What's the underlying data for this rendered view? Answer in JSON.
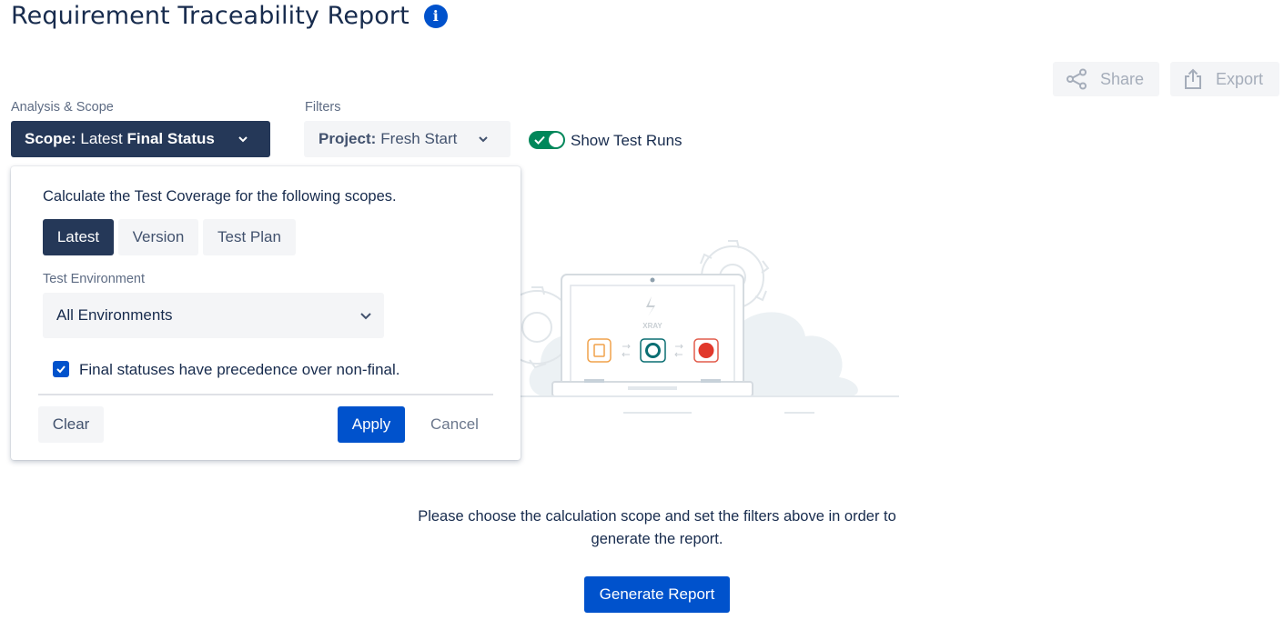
{
  "header": {
    "title": "Requirement Traceability Report",
    "info_glyph": "i"
  },
  "toolbar": {
    "share_label": "Share",
    "export_label": "Export"
  },
  "analysis": {
    "label": "Analysis & Scope",
    "scope_prefix": "Scope:",
    "scope_value": "Latest",
    "scope_suffix": "Final Status"
  },
  "filters": {
    "label": "Filters",
    "project_prefix": "Project:",
    "project_value": "Fresh Start"
  },
  "show_runs": {
    "label": "Show Test Runs",
    "enabled": true
  },
  "popup": {
    "description": "Calculate the Test Coverage for the following scopes.",
    "scopes": [
      {
        "label": "Latest",
        "selected": true
      },
      {
        "label": "Version",
        "selected": false
      },
      {
        "label": "Test Plan",
        "selected": false
      }
    ],
    "environment_label": "Test Environment",
    "environment_value": "All Environments",
    "precedence_label": "Final statuses have precedence over non-final.",
    "precedence_checked": true,
    "clear_label": "Clear",
    "apply_label": "Apply",
    "cancel_label": "Cancel"
  },
  "illustration": {
    "logo_text": "XRAY"
  },
  "main": {
    "hint_line1": "Please choose the calculation scope and set the filters above in order to",
    "hint_line2": "generate the report.",
    "generate_label": "Generate Report"
  },
  "colors": {
    "brand_blue": "#0052cc",
    "dark_navy": "#253858",
    "toggle_green": "#00875a",
    "neutral_bg": "#f4f5f7"
  }
}
